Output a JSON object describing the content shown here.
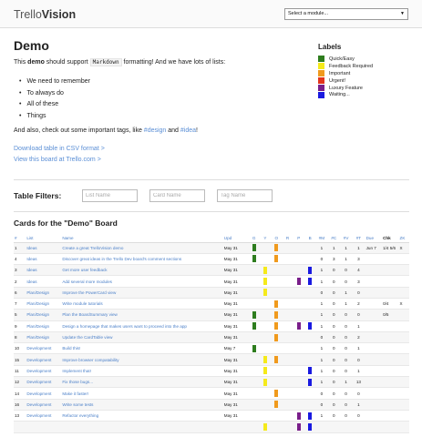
{
  "header": {
    "logo_prefix": "Trello",
    "logo_bold": "Vision",
    "module_select": "Select a module..."
  },
  "board": {
    "title": "Demo",
    "intro": {
      "before": "This ",
      "bold": "demo",
      "middle": " should support ",
      "code": "Markdown",
      "after": " formatting! And we have lots of lists:"
    },
    "bullets": [
      "We need to remember",
      "To always do",
      "All of these",
      "Things"
    ],
    "tags_line": {
      "before": "And also, check out some important tags, like ",
      "tag1": "#design",
      "middle": " and ",
      "tag2": "#idea",
      "after": "!"
    },
    "csv_link": "Download table in CSV format >",
    "trello_link": "View this board at Trello.com >"
  },
  "labels": {
    "title": "Labels",
    "items": [
      {
        "name": "Quick/Easy",
        "color": "#2e7d1e"
      },
      {
        "name": "Feedback Required",
        "color": "#f5ea1b"
      },
      {
        "name": "Important",
        "color": "#f09a1d"
      },
      {
        "name": "Urgent!",
        "color": "#e3351c"
      },
      {
        "name": "Luxury Feature",
        "color": "#7a1f8a"
      },
      {
        "name": "Waiting...",
        "color": "#1a1ae0"
      }
    ]
  },
  "filters": {
    "label": "Table Filters:",
    "list_placeholder": "List Name",
    "card_placeholder": "Card Name",
    "tag_placeholder": "Tag Name"
  },
  "cards": {
    "title": "Cards for the \"Demo\" Board",
    "headers": [
      "#",
      "List",
      "Name",
      "Upd",
      "G",
      "Y",
      "O",
      "R",
      "P",
      "B",
      "#M",
      "#C",
      "#V",
      "#T",
      "Due",
      "Chk",
      "ZK"
    ],
    "label_colors": {
      "G": "#2e7d1e",
      "Y": "#f5ea1b",
      "O": "#f09a1d",
      "R": "#e3351c",
      "P": "#7a1f8a",
      "B": "#1a1ae0"
    },
    "rows": [
      {
        "num": "1",
        "list": "Ideas",
        "name": "Create a great TrelloVision demo",
        "upd": "May 31",
        "labels": [
          "G",
          "O"
        ],
        "m": "1",
        "c": "1",
        "v": "1",
        "t": "1",
        "due": "Jun 7",
        "chk": "1/4 5/6",
        "zk": "X"
      },
      {
        "num": "4",
        "list": "Ideas",
        "name": "Discover great ideas in the Trello Dev board's comment sections",
        "upd": "May 31",
        "labels": [
          "G",
          "O"
        ],
        "m": "0",
        "c": "3",
        "v": "1",
        "t": "3",
        "due": "",
        "chk": "",
        "zk": ""
      },
      {
        "num": "3",
        "list": "Ideas",
        "name": "Get more user feedback",
        "upd": "May 31",
        "labels": [
          "Y",
          "B"
        ],
        "m": "1",
        "c": "0",
        "v": "0",
        "t": "4",
        "due": "",
        "chk": "",
        "zk": ""
      },
      {
        "num": "2",
        "list": "Ideas",
        "name": "Add several more modules",
        "upd": "May 31",
        "labels": [
          "Y",
          "P",
          "B"
        ],
        "m": "1",
        "c": "0",
        "v": "0",
        "t": "3",
        "due": "",
        "chk": "",
        "zk": ""
      },
      {
        "num": "6",
        "list": "Plan/Design",
        "name": "Improve the PowerCard view",
        "upd": "May 31",
        "labels": [
          "Y"
        ],
        "m": "0",
        "c": "0",
        "v": "1",
        "t": "0",
        "due": "",
        "chk": "",
        "zk": ""
      },
      {
        "num": "7",
        "list": "Plan/Design",
        "name": "Write module tutorials",
        "upd": "May 31",
        "labels": [
          "O"
        ],
        "m": "1",
        "c": "0",
        "v": "1",
        "t": "2",
        "due": "",
        "chk": "0/4",
        "zk": "X"
      },
      {
        "num": "5",
        "list": "Plan/Design",
        "name": "Plan the BoardSummary view",
        "upd": "May 31",
        "labels": [
          "G",
          "O"
        ],
        "m": "1",
        "c": "0",
        "v": "0",
        "t": "0",
        "due": "",
        "chk": "0/5",
        "zk": ""
      },
      {
        "num": "9",
        "list": "Plan/Design",
        "name": "Design a homepage that makes users want to proceed into the app",
        "upd": "May 31",
        "labels": [
          "G",
          "O",
          "P",
          "B"
        ],
        "m": "1",
        "c": "0",
        "v": "0",
        "t": "1",
        "due": "",
        "chk": "",
        "zk": ""
      },
      {
        "num": "8",
        "list": "Plan/Design",
        "name": "Update the CardTable view",
        "upd": "May 31",
        "labels": [
          "O"
        ],
        "m": "0",
        "c": "0",
        "v": "0",
        "t": "2",
        "due": "",
        "chk": "",
        "zk": ""
      },
      {
        "num": "10",
        "list": "Development",
        "name": "Build this!",
        "upd": "May 7",
        "labels": [
          "G"
        ],
        "m": "1",
        "c": "0",
        "v": "0",
        "t": "1",
        "due": "",
        "chk": "",
        "zk": ""
      },
      {
        "num": "15",
        "list": "Development",
        "name": "Improve browser compatability",
        "upd": "May 31",
        "labels": [
          "Y",
          "O"
        ],
        "m": "1",
        "c": "0",
        "v": "0",
        "t": "0",
        "due": "",
        "chk": "",
        "zk": ""
      },
      {
        "num": "11",
        "list": "Development",
        "name": "Implement that!",
        "upd": "May 31",
        "labels": [
          "Y",
          "B"
        ],
        "m": "1",
        "c": "0",
        "v": "0",
        "t": "1",
        "due": "",
        "chk": "",
        "zk": ""
      },
      {
        "num": "12",
        "list": "Development",
        "name": "Fix those bugs...",
        "upd": "May 31",
        "labels": [
          "Y",
          "B"
        ],
        "m": "1",
        "c": "0",
        "v": "1",
        "t": "13",
        "due": "",
        "chk": "",
        "zk": ""
      },
      {
        "num": "14",
        "list": "Development",
        "name": "Make it faster!",
        "upd": "May 31",
        "labels": [
          "O"
        ],
        "m": "0",
        "c": "0",
        "v": "0",
        "t": "0",
        "due": "",
        "chk": "",
        "zk": ""
      },
      {
        "num": "16",
        "list": "Development",
        "name": "Write some tests",
        "upd": "May 31",
        "labels": [
          "O"
        ],
        "m": "0",
        "c": "0",
        "v": "0",
        "t": "1",
        "due": "",
        "chk": "",
        "zk": ""
      },
      {
        "num": "13",
        "list": "Development",
        "name": "Refactor everything",
        "upd": "May 31",
        "labels": [
          "P",
          "B"
        ],
        "m": "1",
        "c": "0",
        "v": "0",
        "t": "0",
        "due": "",
        "chk": "",
        "zk": ""
      },
      {
        "num": "",
        "list": "",
        "name": "",
        "upd": "",
        "labels": [
          "Y",
          "P",
          "B"
        ],
        "m": "",
        "c": "",
        "v": "",
        "t": "",
        "due": "",
        "chk": "",
        "zk": ""
      }
    ]
  }
}
